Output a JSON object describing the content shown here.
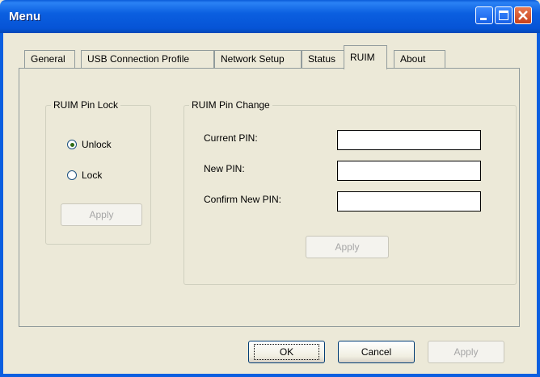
{
  "window": {
    "title": "Menu",
    "controls": {
      "minimize_icon": "minimize-icon",
      "maximize_icon": "maximize-icon",
      "close_icon": "close-icon"
    }
  },
  "tabs": [
    {
      "label": "General",
      "active": false
    },
    {
      "label": "USB Connection Profile",
      "active": false
    },
    {
      "label": "Network Setup",
      "active": false
    },
    {
      "label": "Status",
      "active": false
    },
    {
      "label": "RUIM",
      "active": true
    },
    {
      "label": "About",
      "active": false
    }
  ],
  "pin_lock": {
    "legend": "RUIM Pin Lock",
    "options": [
      {
        "label": "Unlock",
        "checked": true
      },
      {
        "label": "Lock",
        "checked": false
      }
    ],
    "apply_label": "Apply"
  },
  "pin_change": {
    "legend": "RUIM Pin Change",
    "current_label": "Current PIN:",
    "new_label": "New PIN:",
    "confirm_label": "Confirm New PIN:",
    "current_value": "",
    "new_value": "",
    "confirm_value": "",
    "apply_label": "Apply"
  },
  "footer": {
    "ok_label": "OK",
    "cancel_label": "Cancel",
    "apply_label": "Apply"
  },
  "colors": {
    "titlebar": "#0b5fe0",
    "dialog_bg": "#ece9d8",
    "close_button": "#c8401a"
  }
}
